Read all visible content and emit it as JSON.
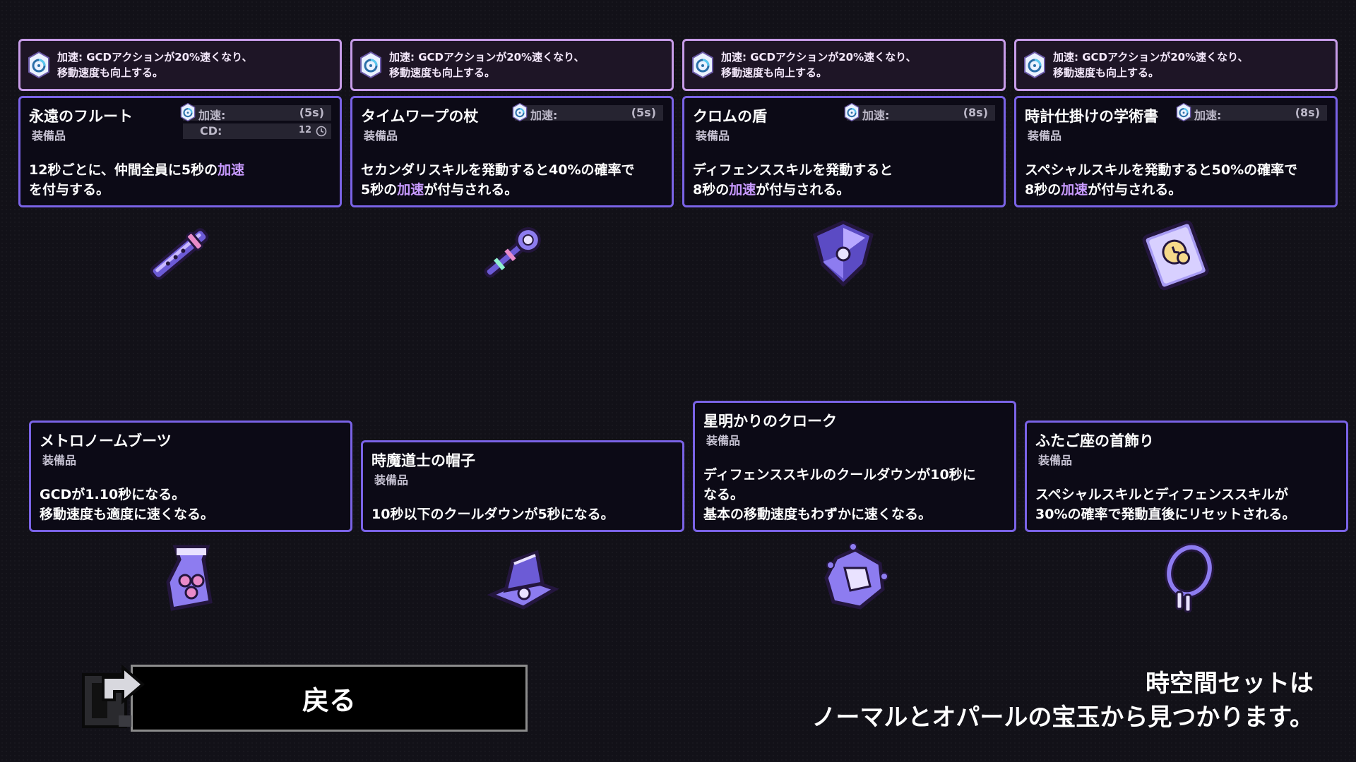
{
  "haste_tooltip": {
    "line1": "加速: GCDアクションが20%速くなり、",
    "line2": "移動速度も向上する。"
  },
  "items_top": [
    {
      "name": "永遠のフルート",
      "type": "装備品",
      "stat_label": "加速:",
      "stat_value": "(5s)",
      "cd_label": "CD:",
      "cd_value": "12",
      "desc1_pre": "12秒ごとに、仲間全員に5秒の",
      "desc1_hl": "加速",
      "desc1_post": "",
      "desc2_pre": "を付与する。",
      "desc2_hl": "",
      "desc2_post": ""
    },
    {
      "name": "タイムワープの杖",
      "type": "装備品",
      "stat_label": "加速:",
      "stat_value": "(5s)",
      "desc1_pre": "セカンダリスキルを発動すると40%の確率で",
      "desc1_hl": "",
      "desc1_post": "",
      "desc2_pre": "5秒の",
      "desc2_hl": "加速",
      "desc2_post": "が付与される。"
    },
    {
      "name": "クロムの盾",
      "type": "装備品",
      "stat_label": "加速:",
      "stat_value": "(8s)",
      "desc1_pre": "ディフェンススキルを発動すると",
      "desc1_hl": "",
      "desc1_post": "",
      "desc2_pre": "8秒の",
      "desc2_hl": "加速",
      "desc2_post": "が付与される。"
    },
    {
      "name": "時計仕掛けの学術書",
      "type": "装備品",
      "stat_label": "加速:",
      "stat_value": "(8s)",
      "desc1_pre": "スペシャルスキルを発動すると50%の確率で",
      "desc1_hl": "",
      "desc1_post": "",
      "desc2_pre": "8秒の",
      "desc2_hl": "加速",
      "desc2_post": "が付与される。"
    }
  ],
  "items_bottom": [
    {
      "name": "メトロノームブーツ",
      "type": "装備品",
      "desc": [
        "GCDが1.10秒になる。",
        "移動速度も適度に速くなる。"
      ]
    },
    {
      "name": "時魔道士の帽子",
      "type": "装備品",
      "desc": [
        "10秒以下のクールダウンが5秒になる。"
      ]
    },
    {
      "name": "星明かりのクローク",
      "type": "装備品",
      "desc": [
        "ディフェンススキルのクールダウンが10秒に",
        "なる。",
        "基本の移動速度もわずかに速くなる。"
      ]
    },
    {
      "name": "ふたご座の首飾り",
      "type": "装備品",
      "desc": [
        "スペシャルスキルとディフェンススキルが",
        "30%の確率で発動直後にリセットされる。"
      ]
    }
  ],
  "back_button": {
    "label": "戻る"
  },
  "footer_note": {
    "line1": "時空間セットは",
    "line2": "ノーマルとオパールの宝玉から見つかります。"
  },
  "colors": {
    "tooltip_border": "#c79ce8",
    "card_border": "#7a63e6",
    "highlight": "#c89aff",
    "background": "#121118"
  }
}
